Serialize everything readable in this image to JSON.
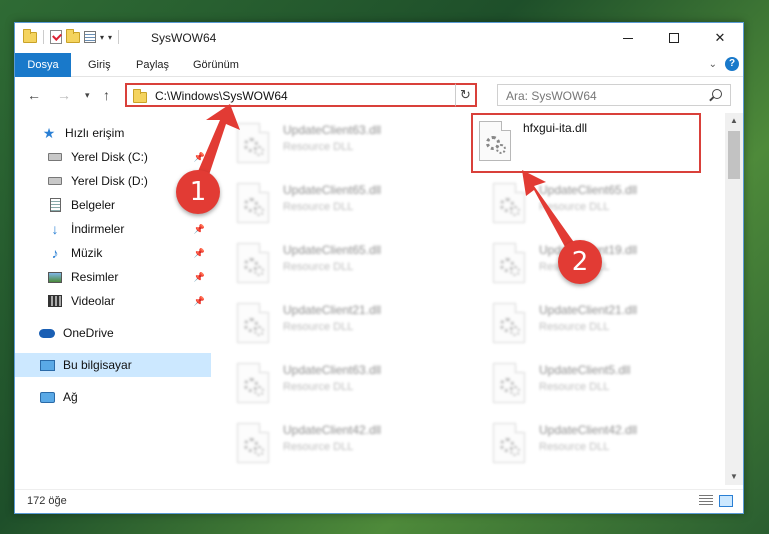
{
  "window": {
    "title": "SysWOW64"
  },
  "ribbon": {
    "tabs": [
      "Dosya",
      "Giriş",
      "Paylaş",
      "Görünüm"
    ]
  },
  "address": {
    "path": "C:\\Windows\\SysWOW64"
  },
  "search": {
    "placeholder": "Ara: SysWOW64"
  },
  "nav": {
    "items": [
      {
        "label": "Hızlı erişim",
        "icon": "star-icon"
      },
      {
        "label": "Yerel Disk (C:)",
        "icon": "disk-icon",
        "pinned": true
      },
      {
        "label": "Yerel Disk (D:)",
        "icon": "disk-icon"
      },
      {
        "label": "Belgeler",
        "icon": "document-icon"
      },
      {
        "label": "İndirmeler",
        "icon": "download-icon",
        "pinned": true
      },
      {
        "label": "Müzik",
        "icon": "music-icon",
        "pinned": true
      },
      {
        "label": "Resimler",
        "icon": "picture-icon",
        "pinned": true
      },
      {
        "label": "Videolar",
        "icon": "video-icon",
        "pinned": true
      },
      {
        "label": "OneDrive",
        "icon": "cloud-icon"
      },
      {
        "label": "Bu bilgisayar",
        "icon": "computer-icon",
        "selected": true
      },
      {
        "label": "Ağ",
        "icon": "network-icon"
      }
    ]
  },
  "files": {
    "left": [
      {
        "name": "UpdateClient63.dll",
        "type": "Resource DLL"
      },
      {
        "name": "UpdateClient65.dll",
        "type": "Resource DLL"
      },
      {
        "name": "UpdateClient65.dll",
        "type": "Resource DLL"
      },
      {
        "name": "UpdateClient21.dll",
        "type": "Resource DLL"
      },
      {
        "name": "UpdateClient63.dll",
        "type": "Resource DLL"
      },
      {
        "name": "UpdateClient42.dll",
        "type": "Resource DLL"
      }
    ],
    "right": [
      {
        "name": "hfxgui-ita.dll",
        "type": "",
        "highlighted": true
      },
      {
        "name": "UpdateClient65.dll",
        "type": "Resource DLL"
      },
      {
        "name": "UpdateClient19.dll",
        "type": "Resource DLL"
      },
      {
        "name": "UpdateClient21.dll",
        "type": "Resource DLL"
      },
      {
        "name": "UpdateClient5.dll",
        "type": "Resource DLL"
      },
      {
        "name": "UpdateClient42.dll",
        "type": "Resource DLL"
      }
    ]
  },
  "status": {
    "count": "172 öğe"
  },
  "callouts": {
    "one": "1",
    "two": "2",
    "color": "#e23b34"
  }
}
